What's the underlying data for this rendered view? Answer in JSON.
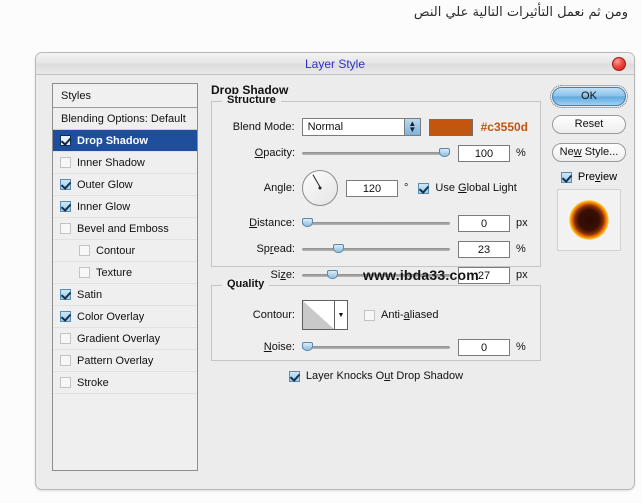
{
  "caption": {
    "arabic_text": "ومن ثم نعمل التأثيرات التالية علي النص"
  },
  "dialog": {
    "title": "Layer Style",
    "close_icon": "close-circle-icon"
  },
  "styles_panel": {
    "header": "Styles",
    "blending_options": "Blending Options: Default",
    "items": [
      {
        "label": "Drop Shadow",
        "checked": true,
        "selected": true,
        "indent": false
      },
      {
        "label": "Inner Shadow",
        "checked": false,
        "selected": false,
        "indent": false
      },
      {
        "label": "Outer Glow",
        "checked": true,
        "selected": false,
        "indent": false
      },
      {
        "label": "Inner Glow",
        "checked": true,
        "selected": false,
        "indent": false
      },
      {
        "label": "Bevel and Emboss",
        "checked": false,
        "selected": false,
        "indent": false
      },
      {
        "label": "Contour",
        "checked": false,
        "selected": false,
        "indent": true
      },
      {
        "label": "Texture",
        "checked": false,
        "selected": false,
        "indent": true
      },
      {
        "label": "Satin",
        "checked": true,
        "selected": false,
        "indent": false
      },
      {
        "label": "Color Overlay",
        "checked": true,
        "selected": false,
        "indent": false
      },
      {
        "label": "Gradient Overlay",
        "checked": false,
        "selected": false,
        "indent": false
      },
      {
        "label": "Pattern Overlay",
        "checked": false,
        "selected": false,
        "indent": false
      },
      {
        "label": "Stroke",
        "checked": false,
        "selected": false,
        "indent": false
      }
    ]
  },
  "panel": {
    "heading": "Drop Shadow",
    "structure": {
      "legend": "Structure",
      "blend_mode_label": "Blend Mode:",
      "blend_mode_value": "Normal",
      "color_hex": "#c3550d",
      "opacity_label": "Opacity:",
      "opacity_value": "100",
      "opacity_unit": "%",
      "angle_label": "Angle:",
      "angle_value": "120",
      "angle_unit": "°",
      "use_global_light_label": "Use Global Light",
      "use_global_light_checked": true,
      "distance_label": "Distance:",
      "distance_value": "0",
      "distance_unit": "px",
      "spread_label": "Spread:",
      "spread_value": "23",
      "spread_unit": "%",
      "size_label": "Size:",
      "size_value": "27",
      "size_unit": "px"
    },
    "quality": {
      "legend": "Quality",
      "contour_label": "Contour:",
      "anti_aliased_label": "Anti-aliased",
      "anti_aliased_checked": false,
      "noise_label": "Noise:",
      "noise_value": "0",
      "noise_unit": "%",
      "knockout_label": "Layer Knocks Out Drop Shadow",
      "knockout_checked": true
    },
    "watermark": "www.ibda33.com"
  },
  "buttons": {
    "ok": "OK",
    "reset": "Reset",
    "new_style": "New Style...",
    "preview_label": "Preview",
    "preview_checked": true
  }
}
